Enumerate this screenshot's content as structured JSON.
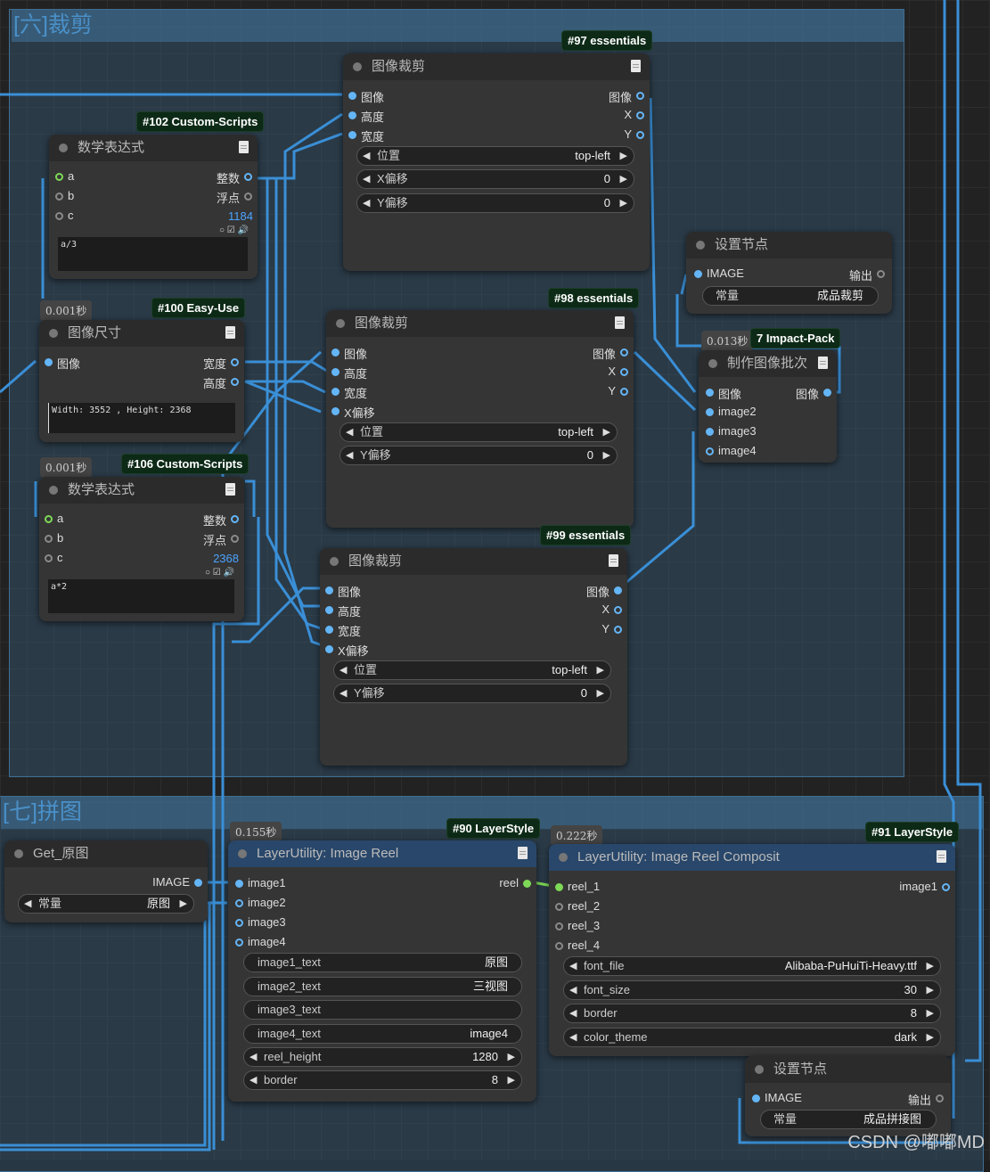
{
  "groups": {
    "crop": {
      "title": "[六]裁剪"
    },
    "stitch": {
      "title": "[七]拼图"
    }
  },
  "nodes": {
    "crop97": {
      "badge": "#97 essentials",
      "title": "图像裁剪",
      "inputs": [
        "图像",
        "高度",
        "宽度"
      ],
      "outputs": [
        "图像",
        "X",
        "Y"
      ],
      "widgets": [
        {
          "label": "位置",
          "value": "top-left"
        },
        {
          "label": "X偏移",
          "value": "0"
        },
        {
          "label": "Y偏移",
          "value": "0"
        }
      ]
    },
    "math102": {
      "badge": "#102 Custom-Scripts",
      "title": "数学表达式",
      "inputs": [
        "a",
        "b",
        "c"
      ],
      "outputs": [
        "整数",
        "浮点"
      ],
      "result": "1184",
      "expression": "a/3"
    },
    "setnode1": {
      "title": "设置节点",
      "input": "IMAGE",
      "output": "输出",
      "widget": {
        "label": "常量",
        "value": "成品裁剪"
      }
    },
    "size100": {
      "timing": "0.001秒",
      "badge": "#100 Easy-Use",
      "title": "图像尺寸",
      "input": "图像",
      "outputs": [
        "宽度",
        "高度"
      ],
      "info": "Width: 3552 , Height: 2368"
    },
    "crop98": {
      "badge": "#98 essentials",
      "title": "图像裁剪",
      "inputs": [
        "图像",
        "高度",
        "宽度",
        "X偏移"
      ],
      "outputs": [
        "图像",
        "X",
        "Y"
      ],
      "widgets": [
        {
          "label": "位置",
          "value": "top-left"
        },
        {
          "label": "Y偏移",
          "value": "0"
        }
      ]
    },
    "batch": {
      "timing": "0.013秒",
      "badge": "7 Impact-Pack",
      "title": "制作图像批次",
      "inputs": [
        "图像",
        "image2",
        "image3",
        "image4"
      ],
      "output": "图像"
    },
    "math106": {
      "timing": "0.001秒",
      "badge": "#106 Custom-Scripts",
      "title": "数学表达式",
      "inputs": [
        "a",
        "b",
        "c"
      ],
      "outputs": [
        "整数",
        "浮点"
      ],
      "result": "2368",
      "expression": "a*2"
    },
    "crop99": {
      "badge": "#99 essentials",
      "title": "图像裁剪",
      "inputs": [
        "图像",
        "高度",
        "宽度",
        "X偏移"
      ],
      "outputs": [
        "图像",
        "X",
        "Y"
      ],
      "widgets": [
        {
          "label": "位置",
          "value": "top-left"
        },
        {
          "label": "Y偏移",
          "value": "0"
        }
      ]
    },
    "getnode": {
      "title": "Get_原图",
      "output": "IMAGE",
      "widget": {
        "label": "常量",
        "value": "原图"
      }
    },
    "reel90": {
      "timing": "0.155秒",
      "badge": "#90 LayerStyle",
      "title": "LayerUtility: Image Reel",
      "inputs": [
        "image1",
        "image2",
        "image3",
        "image4"
      ],
      "output": "reel",
      "widgets": [
        {
          "label": "image1_text",
          "value": "原图"
        },
        {
          "label": "image2_text",
          "value": "三视图"
        },
        {
          "label": "image3_text",
          "value": ""
        },
        {
          "label": "image4_text",
          "value": "image4"
        },
        {
          "label": "reel_height",
          "value": "1280"
        },
        {
          "label": "border",
          "value": "8"
        }
      ]
    },
    "composite91": {
      "timing": "0.222秒",
      "badge": "#91 LayerStyle",
      "title": "LayerUtility: Image Reel Composit",
      "inputs": [
        "reel_1",
        "reel_2",
        "reel_3",
        "reel_4"
      ],
      "output": "image1",
      "widgets": [
        {
          "label": "font_file",
          "value": "Alibaba-PuHuiTi-Heavy.ttf"
        },
        {
          "label": "font_size",
          "value": "30"
        },
        {
          "label": "border",
          "value": "8"
        },
        {
          "label": "color_theme",
          "value": "dark"
        }
      ]
    },
    "setnode2": {
      "title": "设置节点",
      "input": "IMAGE",
      "output": "输出",
      "widget": {
        "label": "常量",
        "value": "成品拼接图"
      }
    }
  },
  "watermark": "CSDN @嘟嘟MD",
  "colors": {
    "wire": "#3a8fd6",
    "slot_image": "#64b5f6",
    "slot_int": "#7ed957",
    "badge_bg": "#0d2a17"
  }
}
